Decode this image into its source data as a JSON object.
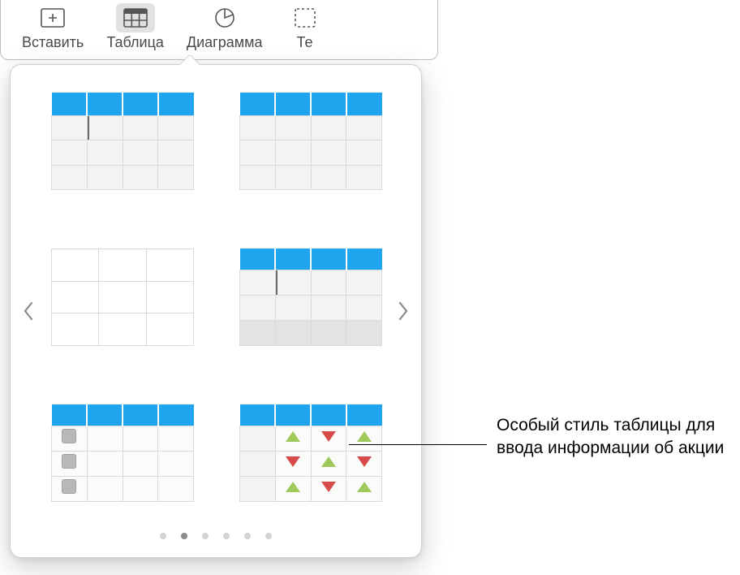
{
  "toolbar": {
    "items": [
      {
        "label": "Вставить"
      },
      {
        "label": "Таблица"
      },
      {
        "label": "Диаграмма"
      },
      {
        "label": "Те"
      }
    ],
    "active_index": 1
  },
  "popover": {
    "styles": [
      {
        "name": "table-style-header-blue-cursor"
      },
      {
        "name": "table-style-header-blue-plain"
      },
      {
        "name": "table-style-plain-white"
      },
      {
        "name": "table-style-header-blue-footer"
      },
      {
        "name": "table-style-header-blue-checkboxes"
      },
      {
        "name": "table-style-header-blue-stock-arrows"
      }
    ],
    "page_count": 6,
    "active_page_index": 1
  },
  "callout": {
    "text": "Особый стиль таблицы для ввода информации об акции"
  },
  "colors": {
    "header_blue": "#1fa4ee",
    "up_green": "#9fc95b",
    "down_red": "#d64a4a"
  }
}
